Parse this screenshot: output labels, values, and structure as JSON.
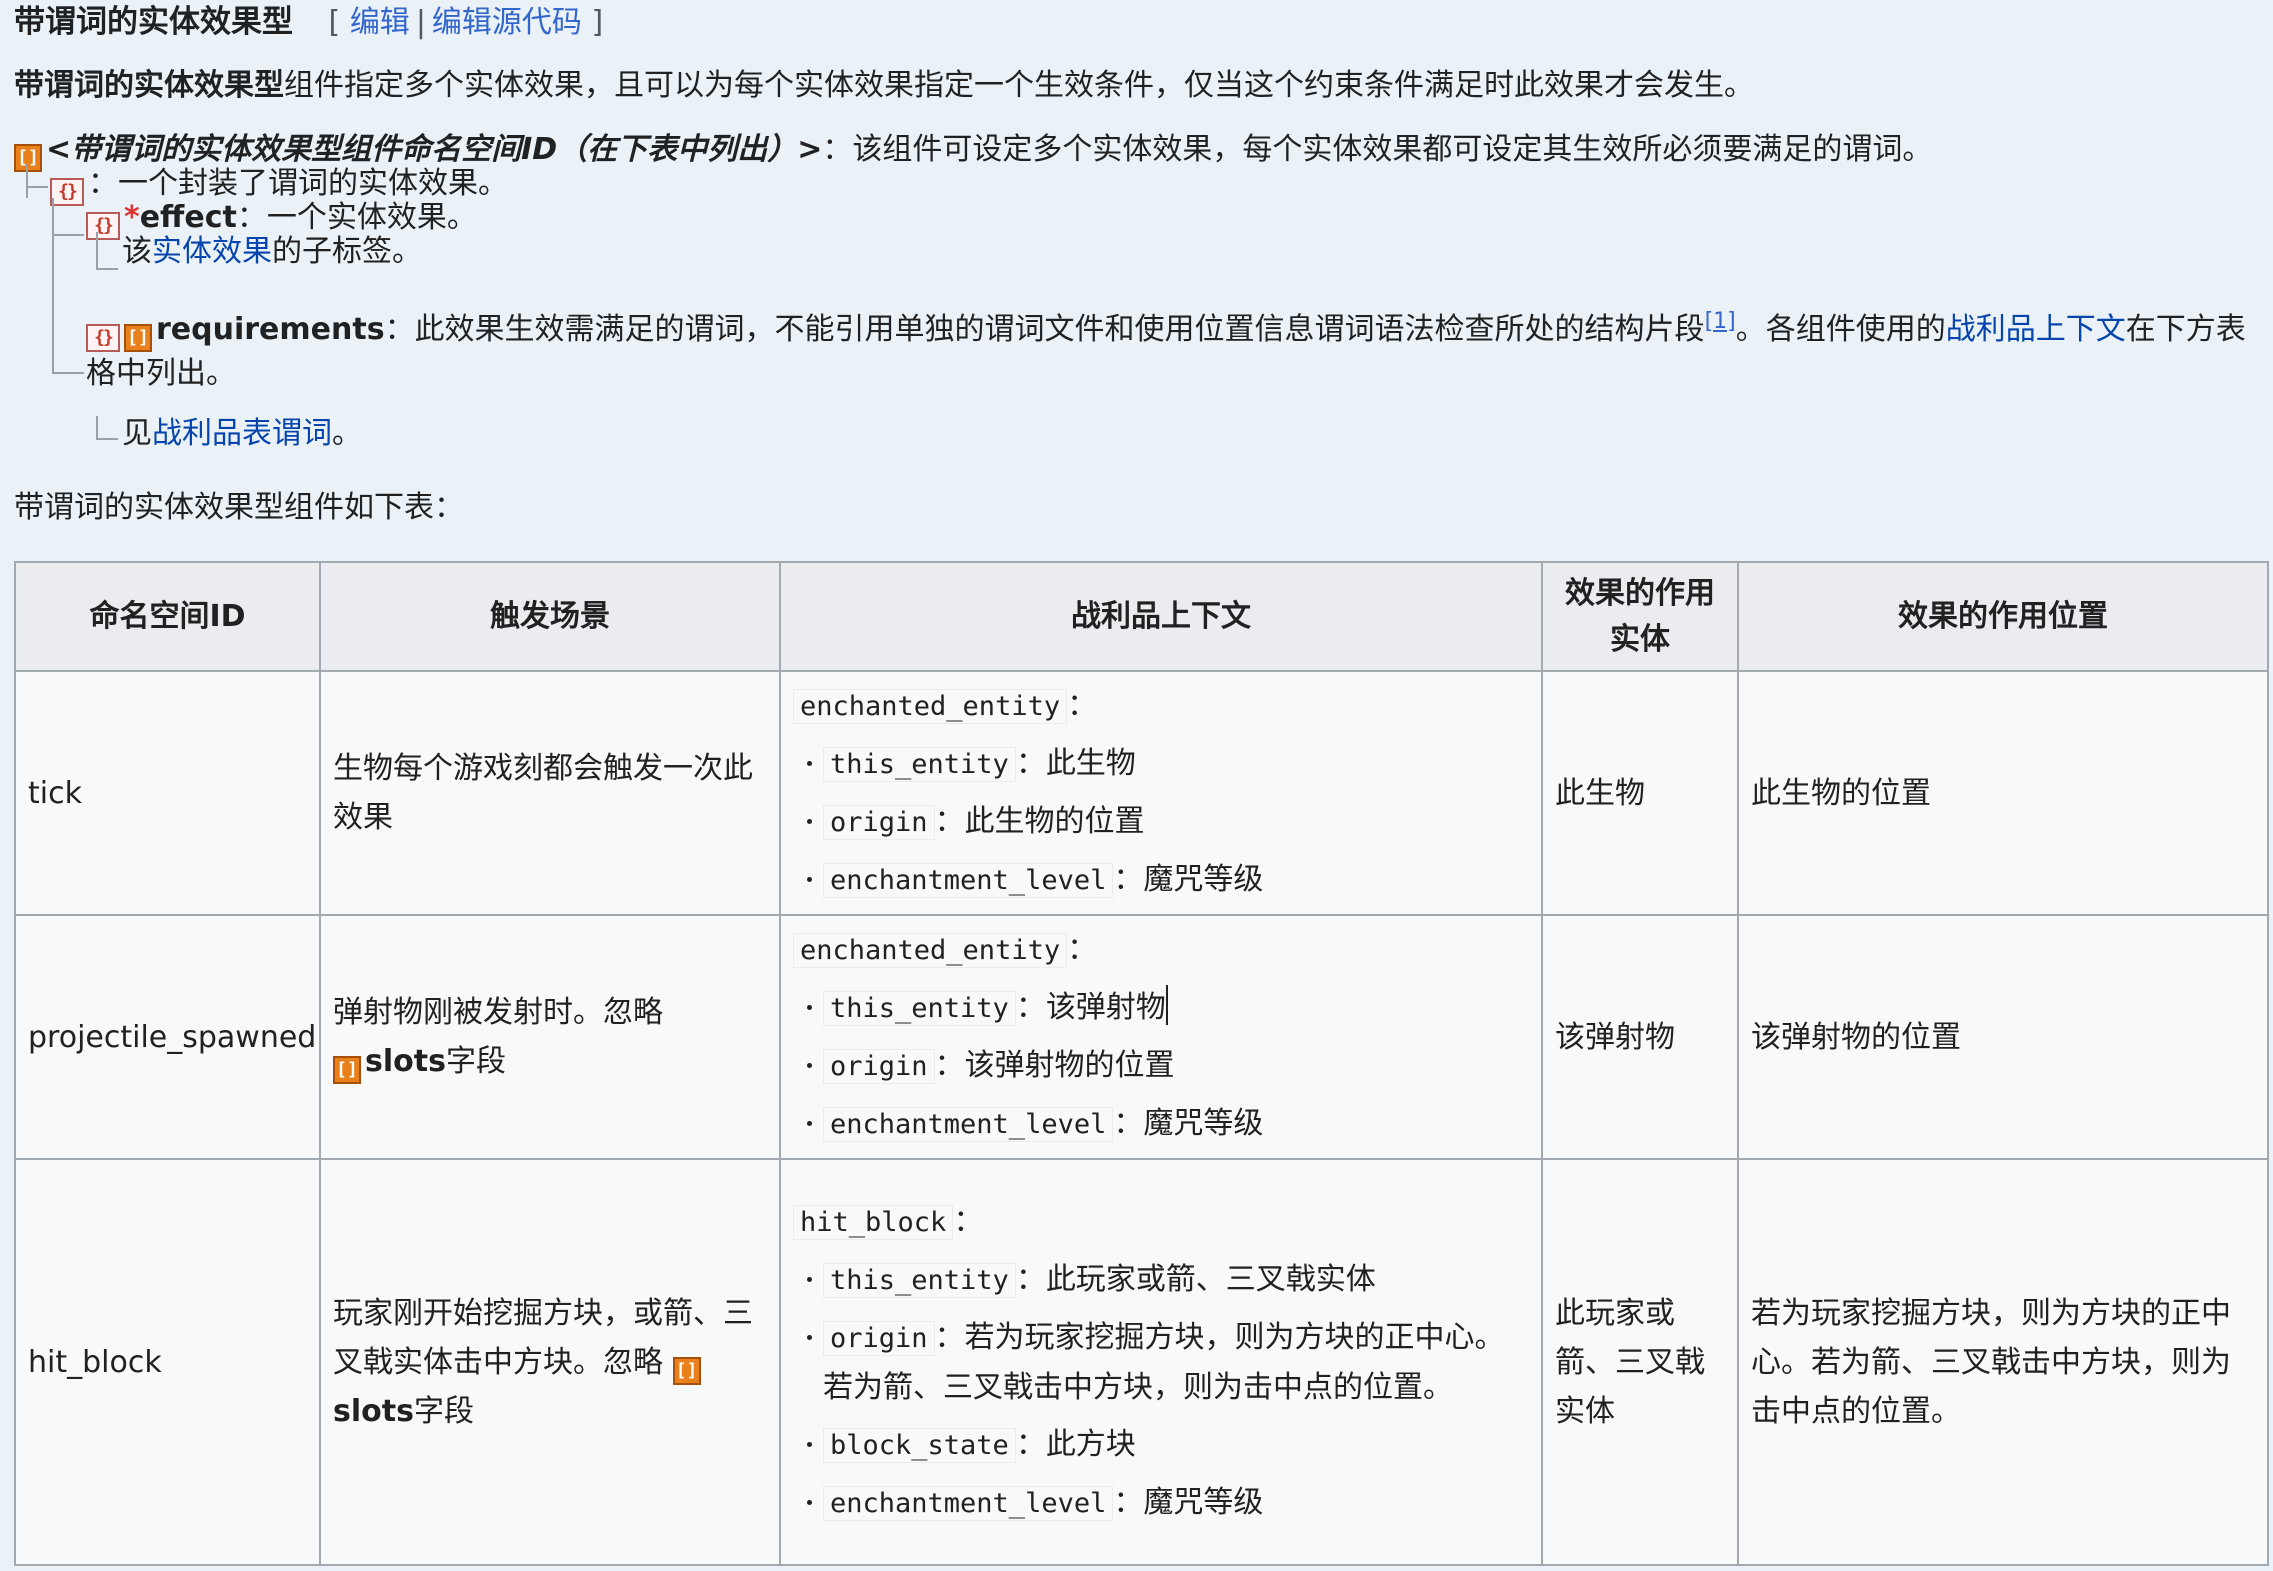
{
  "heading": {
    "title": "带谓词的实体效果型",
    "bracket_open": "[",
    "edit": "编辑",
    "separator": "|",
    "edit_source": "编辑源代码",
    "bracket_close": "]"
  },
  "intro": {
    "bold": "带谓词的实体效果型",
    "rest": "组件指定多个实体效果，且可以为每个实体效果指定一个生效条件，仅当这个约束条件满足时此效果才会发生。"
  },
  "tree": {
    "root_name": "<带谓词的实体效果型组件命名空间ID（在下表中列出）>",
    "root_desc": "：该组件可设定多个实体效果，每个实体效果都可设定其生效所必须要满足的谓词。",
    "item_desc": "：一个封装了谓词的实体效果。",
    "effect_required_mark": "*",
    "effect_name": "effect",
    "effect_desc": "：一个实体效果。",
    "effect_child_pre": "该",
    "effect_child_link": "实体效果",
    "effect_child_post": "的子标签。",
    "req_name": "requirements",
    "req_desc": "：此效果生效需满足的谓词，不能引用单独的谓词文件和使用位置信息谓词语法检查所处的结构片段",
    "req_ref": "[1]",
    "req_desc2": "。各组件使用的",
    "req_link": "战利品上下文",
    "req_desc3": "在下方表格中列出。",
    "req_child_pre": "见",
    "req_child_link": "战利品表谓词",
    "req_child_post": "。"
  },
  "caption": "带谓词的实体效果型组件如下表：",
  "table": {
    "headers": [
      "命名空间ID",
      "触发场景",
      "战利品上下文",
      "效果的作用实体",
      "效果的作用位置"
    ],
    "rows": [
      {
        "id": "tick",
        "trigger": "生物每个游戏刻都会触发一次此效果",
        "context_name": "enchanted_entity",
        "context": [
          {
            "key": "this_entity",
            "desc": "此生物"
          },
          {
            "key": "origin",
            "desc": "此生物的位置"
          },
          {
            "key": "enchantment_level",
            "desc": "魔咒等级"
          }
        ],
        "entity": "此生物",
        "position": "此生物的位置"
      },
      {
        "id": "projectile_spawned",
        "trigger": "弹射物刚被发射时。忽略",
        "trigger_field": "slots",
        "trigger_suffix": "字段",
        "context_name": "enchanted_entity",
        "context": [
          {
            "key": "this_entity",
            "desc": "该弹射物"
          },
          {
            "key": "origin",
            "desc": "该弹射物的位置"
          },
          {
            "key": "enchantment_level",
            "desc": "魔咒等级"
          }
        ],
        "entity": "该弹射物",
        "position": "该弹射物的位置"
      },
      {
        "id": "hit_block",
        "trigger": "玩家刚开始挖掘方块，或箭、三叉戟实体击中方块。忽略",
        "trigger_field": "slots",
        "trigger_suffix": "字段",
        "context_name": "hit_block",
        "context": [
          {
            "key": "this_entity",
            "desc": "此玩家或箭、三叉戟实体"
          },
          {
            "key": "origin",
            "desc": "若为玩家挖掘方块，则为方块的正中心。若为箭、三叉戟击中方块，则为击中点的位置。"
          },
          {
            "key": "block_state",
            "desc": "此方块"
          },
          {
            "key": "enchantment_level",
            "desc": "魔咒等级"
          }
        ],
        "entity": "此玩家或箭、三叉戟实体",
        "position": "若为玩家挖掘方块，则为方块的正中心。若为箭、三叉戟击中方块，则为击中点的位置。"
      }
    ]
  },
  "colon": "：",
  "icons": {
    "list_tag": "list-tag-icon",
    "compound_tag": "compound-tag-icon"
  },
  "colors": {
    "background": "#eaf2f8",
    "link": "#0645ad",
    "list_icon": "#e8801b",
    "table_header": "#eaecf0"
  }
}
